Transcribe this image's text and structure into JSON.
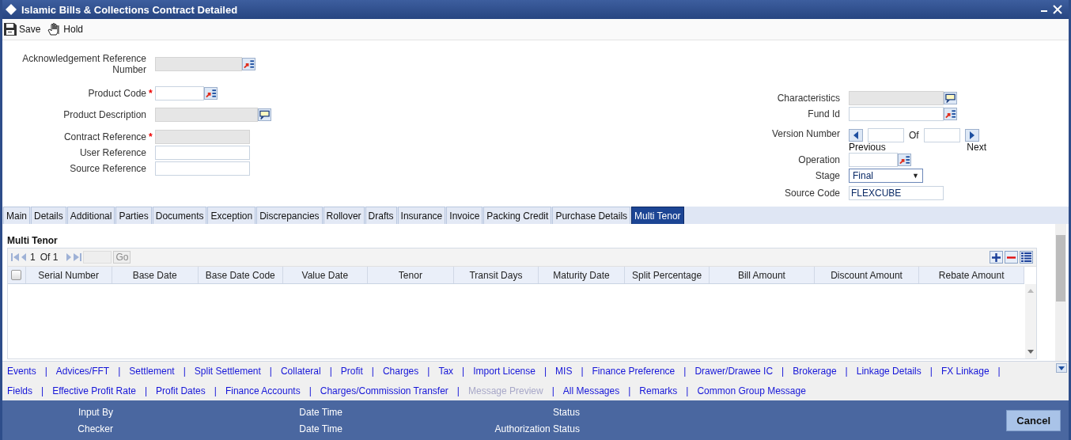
{
  "window": {
    "title": "Islamic Bills & Collections Contract Detailed"
  },
  "toolbar": [
    {
      "label": "Save",
      "kind": "save"
    },
    {
      "label": "Hold",
      "kind": "hold"
    }
  ],
  "form_left": [
    {
      "label": "Acknowledgement Reference Number",
      "kind": "lookup",
      "readonly": true
    },
    {
      "label": "Product Code",
      "marker": "*",
      "kind": "lookup",
      "readonly": false
    },
    {
      "label": "Product Description",
      "kind": "describe",
      "readonly": true
    },
    {
      "label": "Contract Reference",
      "marker": "*",
      "kind": "text",
      "readonly": true
    },
    {
      "label": "User Reference",
      "kind": "text",
      "readonly": false
    },
    {
      "label": "Source Reference",
      "kind": "text",
      "readonly": false
    }
  ],
  "form_right": [
    {
      "label": "Characteristics",
      "kind": "describe",
      "readonly": true
    },
    {
      "label": "Fund Id",
      "kind": "lookup",
      "readonly": false
    },
    {
      "label": "Version Number",
      "kind": "version",
      "of": "Of",
      "previous": "Previous",
      "next": "Next"
    },
    {
      "label": "Operation",
      "kind": "lookup",
      "readonly": false
    },
    {
      "label": "Stage",
      "kind": "select",
      "value": "Final",
      "arrow": "▼"
    },
    {
      "label": "Source Code",
      "kind": "text",
      "readonly": false,
      "value": "FLEXCUBE"
    }
  ],
  "tabs": [
    {
      "label": "Main",
      "selected": false
    },
    {
      "label": "Details",
      "selected": false
    },
    {
      "label": "Additional",
      "selected": false
    },
    {
      "label": "Parties",
      "selected": false
    },
    {
      "label": "Documents",
      "selected": false
    },
    {
      "label": "Exception",
      "selected": false
    },
    {
      "label": "Discrepancies",
      "selected": false
    },
    {
      "label": "Rollover",
      "selected": false
    },
    {
      "label": "Drafts",
      "selected": false
    },
    {
      "label": "Insurance",
      "selected": false
    },
    {
      "label": "Invoice",
      "selected": false
    },
    {
      "label": "Packing Credit",
      "selected": false
    },
    {
      "label": "Purchase Details",
      "selected": false
    },
    {
      "label": "Multi Tenor",
      "selected": true
    }
  ],
  "section": {
    "title": "Multi Tenor",
    "pager": {
      "page": "1",
      "of": "Of 1",
      "go": "Go"
    },
    "table": {
      "select_all_checked": false,
      "columns": [
        "Serial Number",
        "Base Date",
        "Base Date Code",
        "Value Date",
        "Tenor",
        "Transit Days",
        "Maturity Date",
        "Split Percentage",
        "Bill Amount",
        "Discount Amount",
        "Rebate Amount"
      ]
    }
  },
  "link_separator": "|",
  "link_rows": [
    [
      {
        "label": "Events",
        "disabled": false
      },
      {
        "label": "Advices/FFT",
        "disabled": false
      },
      {
        "label": "Settlement",
        "disabled": false
      },
      {
        "label": "Split Settlement",
        "disabled": false
      },
      {
        "label": "Collateral",
        "disabled": false
      },
      {
        "label": "Profit",
        "disabled": false
      },
      {
        "label": "Charges",
        "disabled": false
      },
      {
        "label": "Tax",
        "disabled": false
      },
      {
        "label": "Import License",
        "disabled": false
      },
      {
        "label": "MIS",
        "disabled": false
      },
      {
        "label": "Finance Preference",
        "disabled": false
      },
      {
        "label": "Drawer/Drawee IC",
        "disabled": false
      },
      {
        "label": "Brokerage",
        "disabled": false
      },
      {
        "label": "Linkage Details",
        "disabled": false
      },
      {
        "label": "FX Linkage",
        "disabled": false
      }
    ],
    [
      {
        "label": "Fields",
        "disabled": false
      },
      {
        "label": "Effective Profit Rate",
        "disabled": false
      },
      {
        "label": "Profit Dates",
        "disabled": false
      },
      {
        "label": "Finance Accounts",
        "disabled": false
      },
      {
        "label": "Charges/Commission Transfer",
        "disabled": false
      },
      {
        "label": "Message Preview",
        "disabled": true
      },
      {
        "label": "All Messages",
        "disabled": false
      },
      {
        "label": "Remarks",
        "disabled": false
      },
      {
        "label": "Common Group Message",
        "disabled": false
      }
    ]
  ],
  "audit": [
    [
      "Input By",
      "Date Time",
      "Status"
    ],
    [
      "Checker",
      "Date Time",
      "Authorization Status"
    ]
  ],
  "cancel_button": "Cancel"
}
